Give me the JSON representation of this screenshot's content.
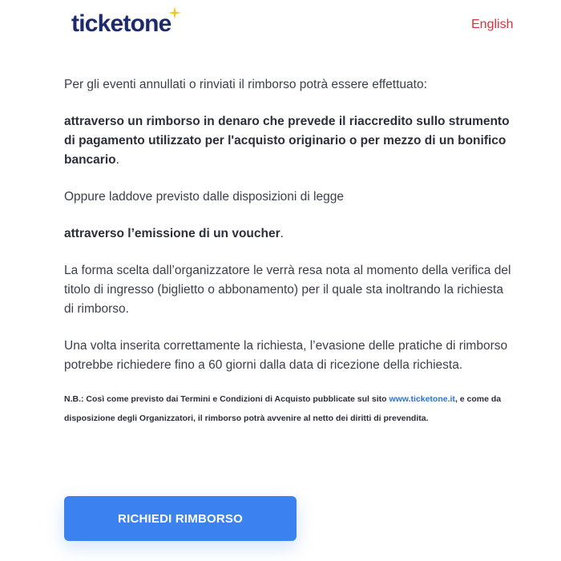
{
  "header": {
    "logo_text": "ticketone",
    "logo_icon": "sparkle-star-icon",
    "language_label": "English"
  },
  "content": {
    "intro": "Per gli eventi annullati o rinviati il rimborso potrà essere effettuato:",
    "option_money": "attraverso un rimborso in denaro che prevede il riaccredito sullo strumento di pagamento utilizzato per l'acquisto originario o per mezzo di un bonifico bancario",
    "option_money_end": ".",
    "alternative": "Oppure laddove previsto dalle disposizioni di legge",
    "option_voucher": "attraverso l’emissione di un voucher",
    "option_voucher_end": ".",
    "form_note": "La forma scelta dall’organizzatore le verrà resa nota al momento della verifica del titolo di ingresso (biglietto o abbonamento) per il quale sta inoltrando la richiesta di rimborso.",
    "timing": "Una volta inserita correttamente la richiesta, l’evasione delle pratiche di rimborso potrebbe richiedere fino a 60 giorni dalla data di ricezione della richiesta.",
    "nb_prefix": "N.B.: Così come previsto dai Termini e Condizioni di Acquisto pubblicate sul sito ",
    "nb_link": "www.ticketone.it",
    "nb_suffix": ", e come da disposizione degli Organizzatori, il rimborso potrà avvenire al netto dei diritti di prevendita."
  },
  "actions": {
    "request_refund_label": "RICHIEDI RIMBORSO"
  },
  "colors": {
    "brand_navy": "#1d2a6b",
    "accent_blue": "#3b82f0",
    "link_blue": "#2f73c9",
    "language_red": "#e0303a",
    "star_yellow": "#f5c518"
  }
}
